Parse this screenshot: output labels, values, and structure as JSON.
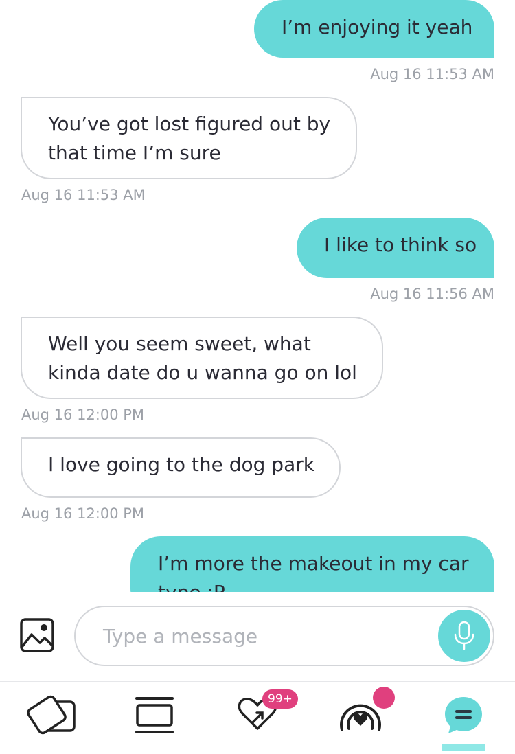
{
  "messages": [
    {
      "text": "I’m enjoying it yeah",
      "time": "Aug 16 11:53 AM",
      "direction": "sent"
    },
    {
      "text_lines": [
        "You’ve got lost figured out by",
        "that time I’m sure"
      ],
      "time": "Aug 16 11:53 AM",
      "direction": "received"
    },
    {
      "text": "I like to think so",
      "time": "Aug 16 11:56 AM",
      "direction": "sent"
    },
    {
      "text_lines": [
        "Well you seem sweet, what",
        "kinda date do u wanna go on lol"
      ],
      "time": "Aug 16 12:00 PM",
      "direction": "received"
    },
    {
      "text": "I love going to the dog park",
      "time": "Aug 16 12:00 PM",
      "direction": "received"
    },
    {
      "text_lines": [
        "I’m more the makeout in my car",
        "type :P"
      ],
      "direction": "sent"
    }
  ],
  "composer": {
    "placeholder": "Type a message"
  },
  "nav": {
    "items": [
      {
        "icon": "cards-icon"
      },
      {
        "icon": "stack-icon"
      },
      {
        "icon": "likes-heart-icon",
        "badge": "99+"
      },
      {
        "icon": "broadcast-heart-icon",
        "has_dot": true
      },
      {
        "icon": "chat-icon",
        "active": true
      }
    ]
  },
  "colors": {
    "sent_bubble": "#66d8d8",
    "accent": "#66d8d8",
    "badge": "#e0407e",
    "timestamp": "#9da1a8"
  }
}
